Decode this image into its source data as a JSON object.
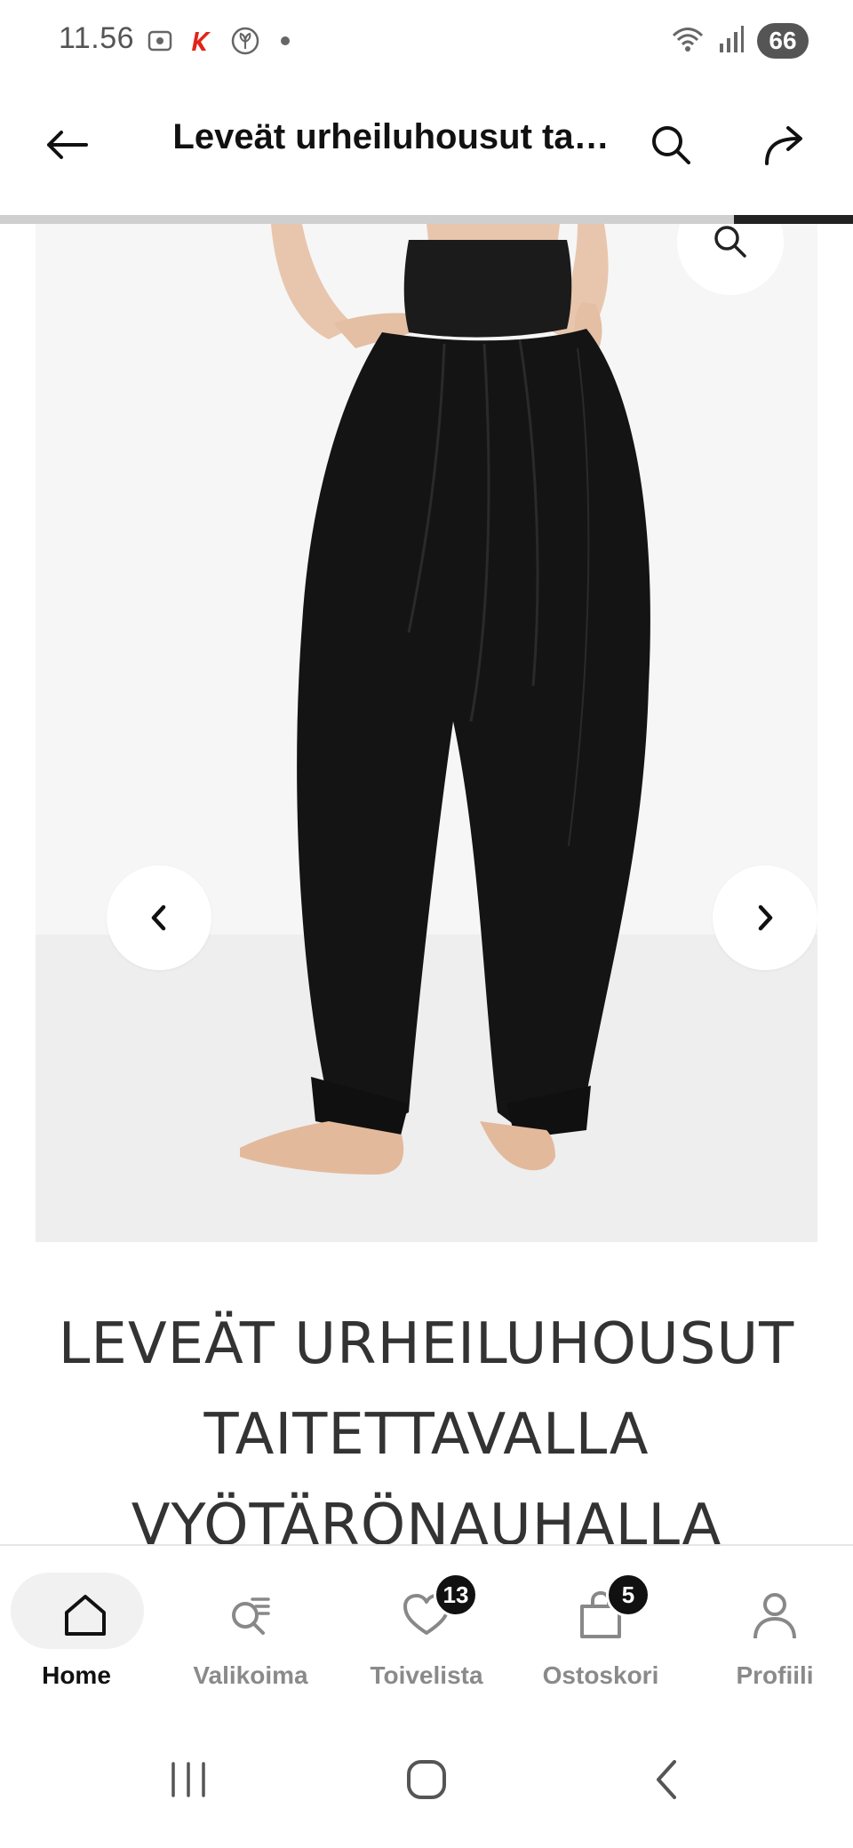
{
  "status_bar": {
    "time": "11.56",
    "battery": "66",
    "icons": [
      "screenshot-icon",
      "k-app-icon",
      "leaf-app-icon",
      "notification-dot",
      "wifi-icon",
      "signal-icon"
    ]
  },
  "app_bar": {
    "title": "Leveät urheiluhousut ta…",
    "icons": [
      "back-arrow-icon",
      "search-icon",
      "share-icon"
    ]
  },
  "gallery": {
    "progress_fraction": 0.14,
    "icons": [
      "zoom-icon",
      "chevron-left-icon",
      "chevron-right-icon"
    ]
  },
  "product": {
    "title_lines": [
      "LEVEÄT URHEILUHOUSUT",
      "TAITETTAVALLA",
      "VYÖTÄRÖNAUHALLA"
    ]
  },
  "bottom_nav": {
    "items": [
      {
        "label": "Home",
        "icon": "home-icon",
        "active": true
      },
      {
        "label": "Valikoima",
        "icon": "catalog-search-icon",
        "active": false
      },
      {
        "label": "Toivelista",
        "icon": "heart-icon",
        "active": false,
        "badge": "13"
      },
      {
        "label": "Ostoskori",
        "icon": "shopping-bag-icon",
        "active": false,
        "badge": "5"
      },
      {
        "label": "Profiili",
        "icon": "profile-icon",
        "active": false
      }
    ]
  },
  "system_nav": {
    "icons": [
      "recents-icon",
      "home-circle-icon",
      "back-chevron-icon"
    ]
  },
  "colors": {
    "active_text": "#111111",
    "inactive_text": "#8a8a8a",
    "badge_bg": "#111111",
    "k_brand": "#e2231a"
  }
}
